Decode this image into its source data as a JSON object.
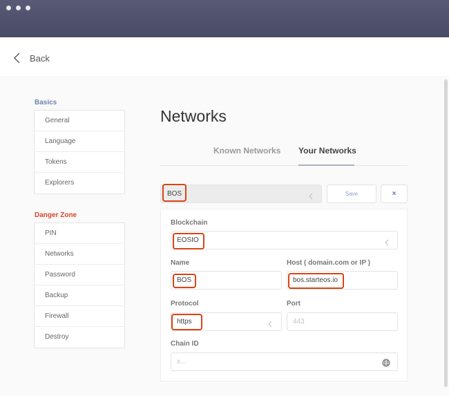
{
  "window": {
    "controls": [
      "window-dot",
      "window-dot",
      "window-dot"
    ]
  },
  "topbar": {
    "back_label": "Back",
    "back_icon": "chevron-left-icon"
  },
  "sidebar": {
    "basics_heading": "Basics",
    "basics_items": [
      "General",
      "Language",
      "Tokens",
      "Explorers"
    ],
    "danger_heading": "Danger Zone",
    "danger_items": [
      "PIN",
      "Networks",
      "Password",
      "Backup",
      "Firewall",
      "Destroy"
    ],
    "colors": {
      "basics_heading": "#6b7fb0",
      "danger_heading": "#d9452b"
    }
  },
  "main": {
    "title": "Networks",
    "tabs": [
      {
        "label": "Known Networks",
        "active": false
      },
      {
        "label": "Your Networks",
        "active": true
      }
    ],
    "network_select": {
      "value": "BOS",
      "icon": "chevron-left-icon"
    },
    "save_label": "Save",
    "close_label": "×",
    "form": {
      "blockchain_label": "Blockchain",
      "blockchain_value": "EOSIO",
      "name_label": "Name",
      "name_value": "BOS",
      "host_label": "Host ( domain.com or IP )",
      "host_value": "bos.starteos.io",
      "protocol_label": "Protocol",
      "protocol_value": "https",
      "port_label": "Port",
      "port_placeholder": "443",
      "chain_id_label": "Chain ID",
      "chain_id_placeholder": "x...",
      "chain_id_icon": "globe-icon"
    },
    "highlight_color": "#d84315"
  }
}
